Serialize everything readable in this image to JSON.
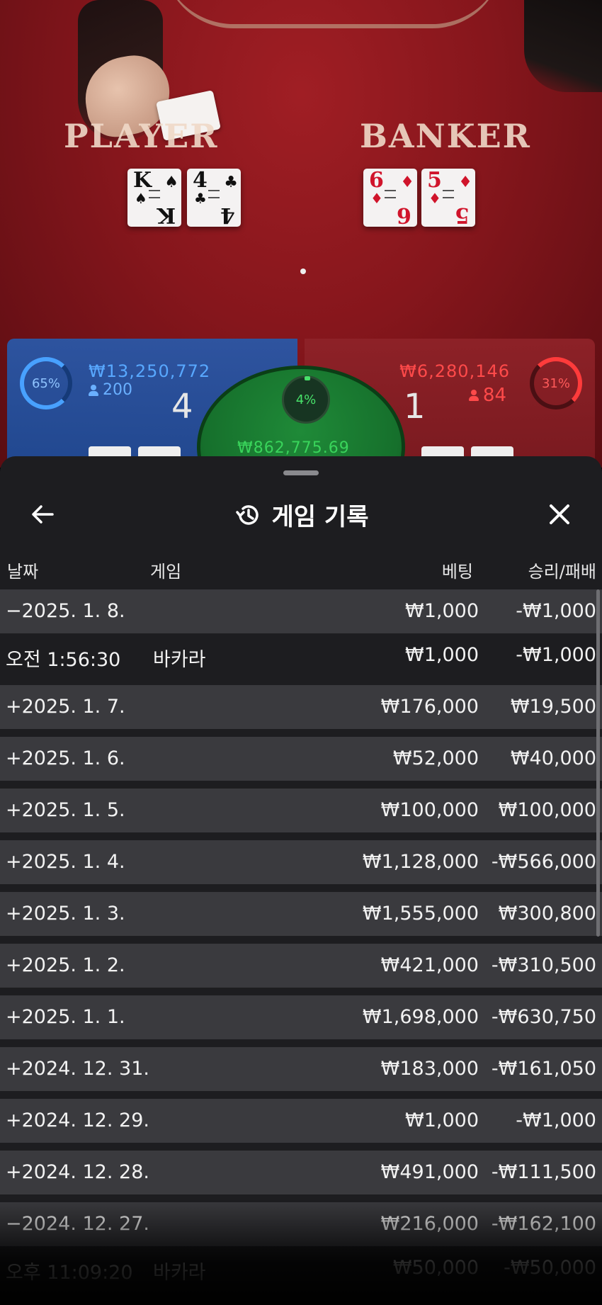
{
  "table": {
    "player_label": "PLAYER",
    "banker_label": "BANKER",
    "player_cards": [
      {
        "rank": "K",
        "suit": "♠",
        "color": "black"
      },
      {
        "rank": "4",
        "suit": "♣",
        "color": "black"
      }
    ],
    "banker_cards": [
      {
        "rank": "6",
        "suit": "♦",
        "color": "red"
      },
      {
        "rank": "5",
        "suit": "♦",
        "color": "red"
      }
    ]
  },
  "bets": {
    "player": {
      "percent": "65%",
      "amount": "₩13,250,772",
      "players": "200",
      "score": "4",
      "color": "#48a1ff"
    },
    "tie": {
      "percent": "4%",
      "amount": "₩862,775.69",
      "color": "#39d45b"
    },
    "banker": {
      "percent": "31%",
      "amount": "₩6,280,146",
      "players": "84",
      "score": "1",
      "color": "#ff4a4a"
    }
  },
  "history": {
    "title": "게임 기록",
    "icons": {
      "back": "back-arrow-icon",
      "history": "history-clock-icon",
      "close": "close-icon"
    },
    "columns": {
      "date": "날짜",
      "game": "게임",
      "bet": "베팅",
      "result": "승리/패배"
    },
    "rows": [
      {
        "date": "−2025. 1. 8.",
        "game": "",
        "bet": "₩1,000",
        "result": "-₩1,000",
        "detail": false
      },
      {
        "date": "오전 1:56:30",
        "game": "바카라",
        "bet": "₩1,000",
        "result": "-₩1,000",
        "detail": true
      },
      {
        "date": "+2025. 1. 7.",
        "game": "",
        "bet": "₩176,000",
        "result": "₩19,500",
        "detail": false
      },
      {
        "date": "+2025. 1. 6.",
        "game": "",
        "bet": "₩52,000",
        "result": "₩40,000",
        "detail": false
      },
      {
        "date": "+2025. 1. 5.",
        "game": "",
        "bet": "₩100,000",
        "result": "₩100,000",
        "detail": false
      },
      {
        "date": "+2025. 1. 4.",
        "game": "",
        "bet": "₩1,128,000",
        "result": "-₩566,000",
        "detail": false
      },
      {
        "date": "+2025. 1. 3.",
        "game": "",
        "bet": "₩1,555,000",
        "result": "₩300,800",
        "detail": false
      },
      {
        "date": "+2025. 1. 2.",
        "game": "",
        "bet": "₩421,000",
        "result": "-₩310,500",
        "detail": false
      },
      {
        "date": "+2025. 1. 1.",
        "game": "",
        "bet": "₩1,698,000",
        "result": "-₩630,750",
        "detail": false
      },
      {
        "date": "+2024. 12. 31.",
        "game": "",
        "bet": "₩183,000",
        "result": "-₩161,050",
        "detail": false
      },
      {
        "date": "+2024. 12. 29.",
        "game": "",
        "bet": "₩1,000",
        "result": "-₩1,000",
        "detail": false
      },
      {
        "date": "+2024. 12. 28.",
        "game": "",
        "bet": "₩491,000",
        "result": "-₩111,500",
        "detail": false
      },
      {
        "date": "−2024. 12. 27.",
        "game": "",
        "bet": "₩216,000",
        "result": "-₩162,100",
        "detail": false
      },
      {
        "date": "오후 11:09:20",
        "game": "바카라",
        "bet": "₩50,000",
        "result": "-₩50,000",
        "detail": true
      }
    ]
  }
}
